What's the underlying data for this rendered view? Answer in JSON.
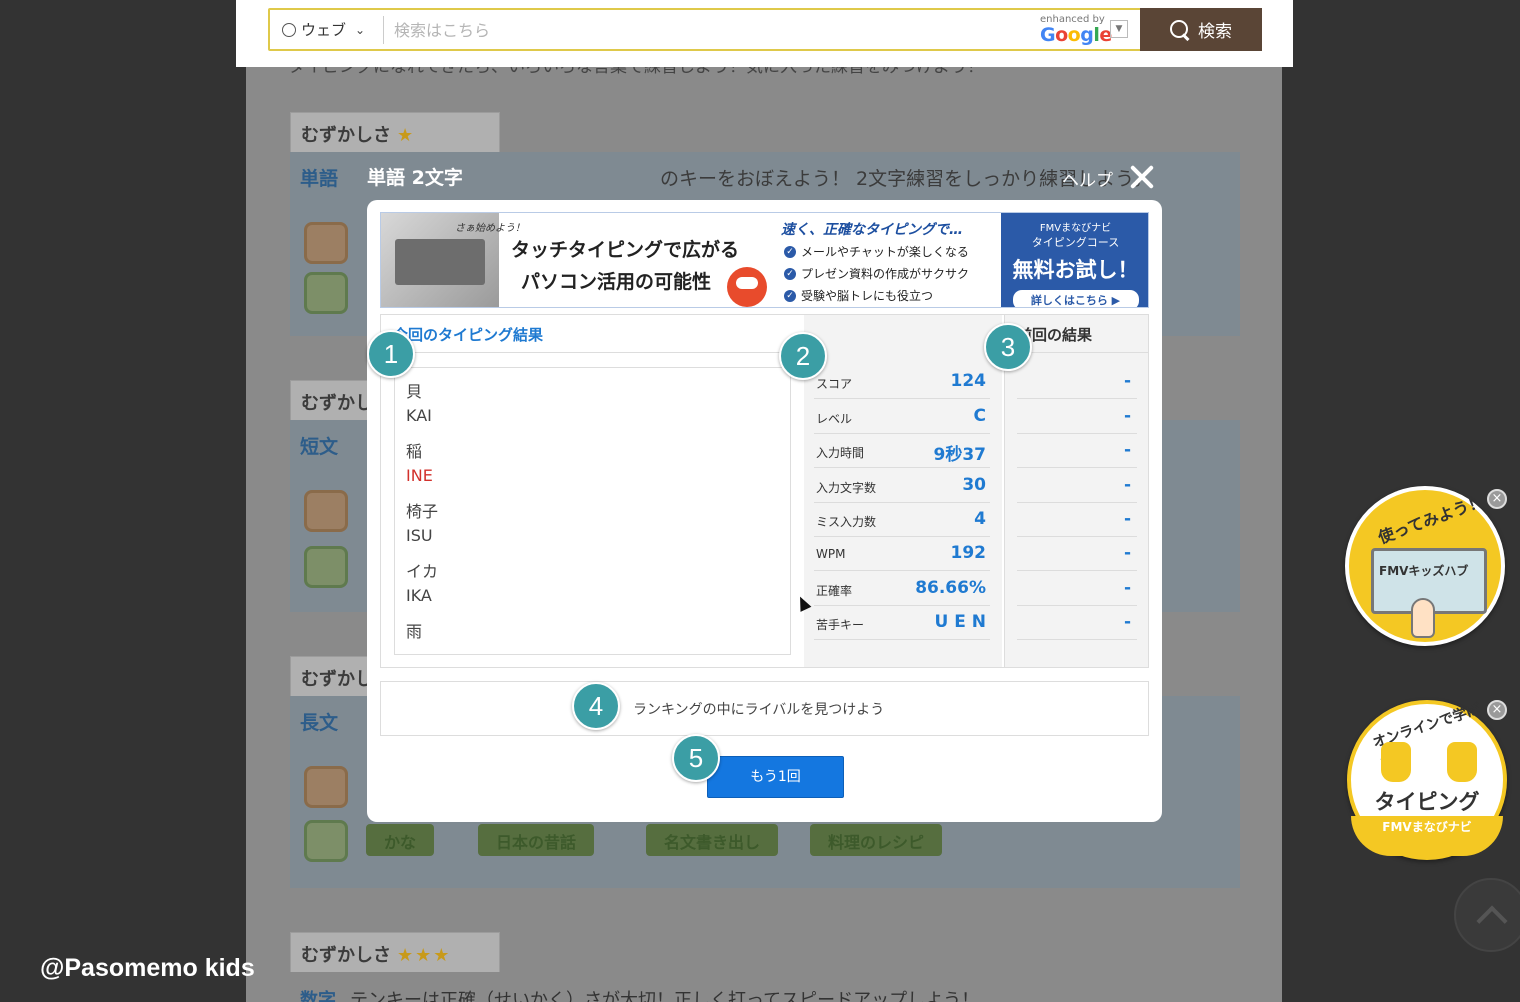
{
  "search": {
    "scope_label": "ウェブ",
    "placeholder": "検索はこちら",
    "enhanced_by": "enhanced by",
    "google_letters": [
      "G",
      "o",
      "o",
      "g",
      "l",
      "e"
    ],
    "button_label": "検索"
  },
  "background": {
    "intro_text": "タイピングになれてきたら、いろいろな言葉で練習しよう！気に入った練習をみつけよう！",
    "difficulty_label": "むずかしさ",
    "sections": [
      {
        "stars": "★",
        "title": "単語",
        "description": "のキーをおぼえよう！ 2文字練習をしっかり練習しよう。"
      },
      {
        "stars": "",
        "title": "短文",
        "description": ""
      },
      {
        "stars": "",
        "title": "長文",
        "description": "",
        "chips": [
          "かな",
          "日本の昔話",
          "名文書き出し",
          "料理のレシピ"
        ]
      },
      {
        "stars": "★★★",
        "title": "数字",
        "description": "テンキーは正確（せいかく）さが大切！正しく打ってスピードアップしよう！"
      }
    ]
  },
  "modal": {
    "title": "単語 2文字",
    "help_label": "ヘルプ",
    "banner": {
      "bubble": "さぁ始めよう！",
      "headline_1": "タッチタイピングで広がる",
      "headline_2": "パソコン活用の可能性",
      "right_heading": "速く、正確なタイピングで…",
      "bullets": [
        "メールやチャットが楽しくなる",
        "プレゼン資料の作成がサクサク",
        "受験や脳トレにも役立つ"
      ],
      "cta_line1": "FMVまなびナビ",
      "cta_line2": "タイピングコース",
      "cta_main": "無料お試し！",
      "cta_button": "詳しくはこちら ▶"
    },
    "results_title": "今回のタイピング結果",
    "previous_title": "前回の結果",
    "words": [
      {
        "kanji": "貝",
        "romaji": "KAI",
        "miss": false
      },
      {
        "kanji": "稲",
        "romaji": "INE",
        "miss": true
      },
      {
        "kanji": "椅子",
        "romaji": "ISU",
        "miss": false
      },
      {
        "kanji": "イカ",
        "romaji": "IKA",
        "miss": false
      },
      {
        "kanji": "雨",
        "romaji": "",
        "miss": false
      }
    ],
    "stats": [
      {
        "label": "スコア",
        "value": "124",
        "previous": "-"
      },
      {
        "label": "レベル",
        "value": "C",
        "previous": "-"
      },
      {
        "label": "入力時間",
        "value": "9秒37",
        "previous": "-"
      },
      {
        "label": "入力文字数",
        "value": "30",
        "previous": "-"
      },
      {
        "label": "ミス入力数",
        "value": "4",
        "previous": "-"
      },
      {
        "label": "WPM",
        "value": "192",
        "previous": "-"
      },
      {
        "label": "正確率",
        "value": "86.66%",
        "previous": "-"
      },
      {
        "label": "苦手キー",
        "value": "U E N",
        "previous": "-"
      }
    ],
    "ranking_text": "ランキングの中にライバルを見つけよう",
    "retry_label": "もう1回"
  },
  "callouts": [
    "1",
    "2",
    "3",
    "4",
    "5"
  ],
  "widgets": {
    "kids_hub_top": "使ってみよう！",
    "kids_hub_label": "FMVキッズハブ",
    "typing_top": "オンラインで学ぼう！",
    "typing_main": "タイピング",
    "typing_footer": "FMVまなびナビ"
  },
  "watermark": "@Pasomemo kids",
  "colors": {
    "accent_blue": "#1f7ad1",
    "button_blue": "#1477e0",
    "callout_teal": "#3b9ea5",
    "miss_red": "#d2312c",
    "search_button": "#5a4536",
    "widget_yellow": "#f4c823"
  }
}
